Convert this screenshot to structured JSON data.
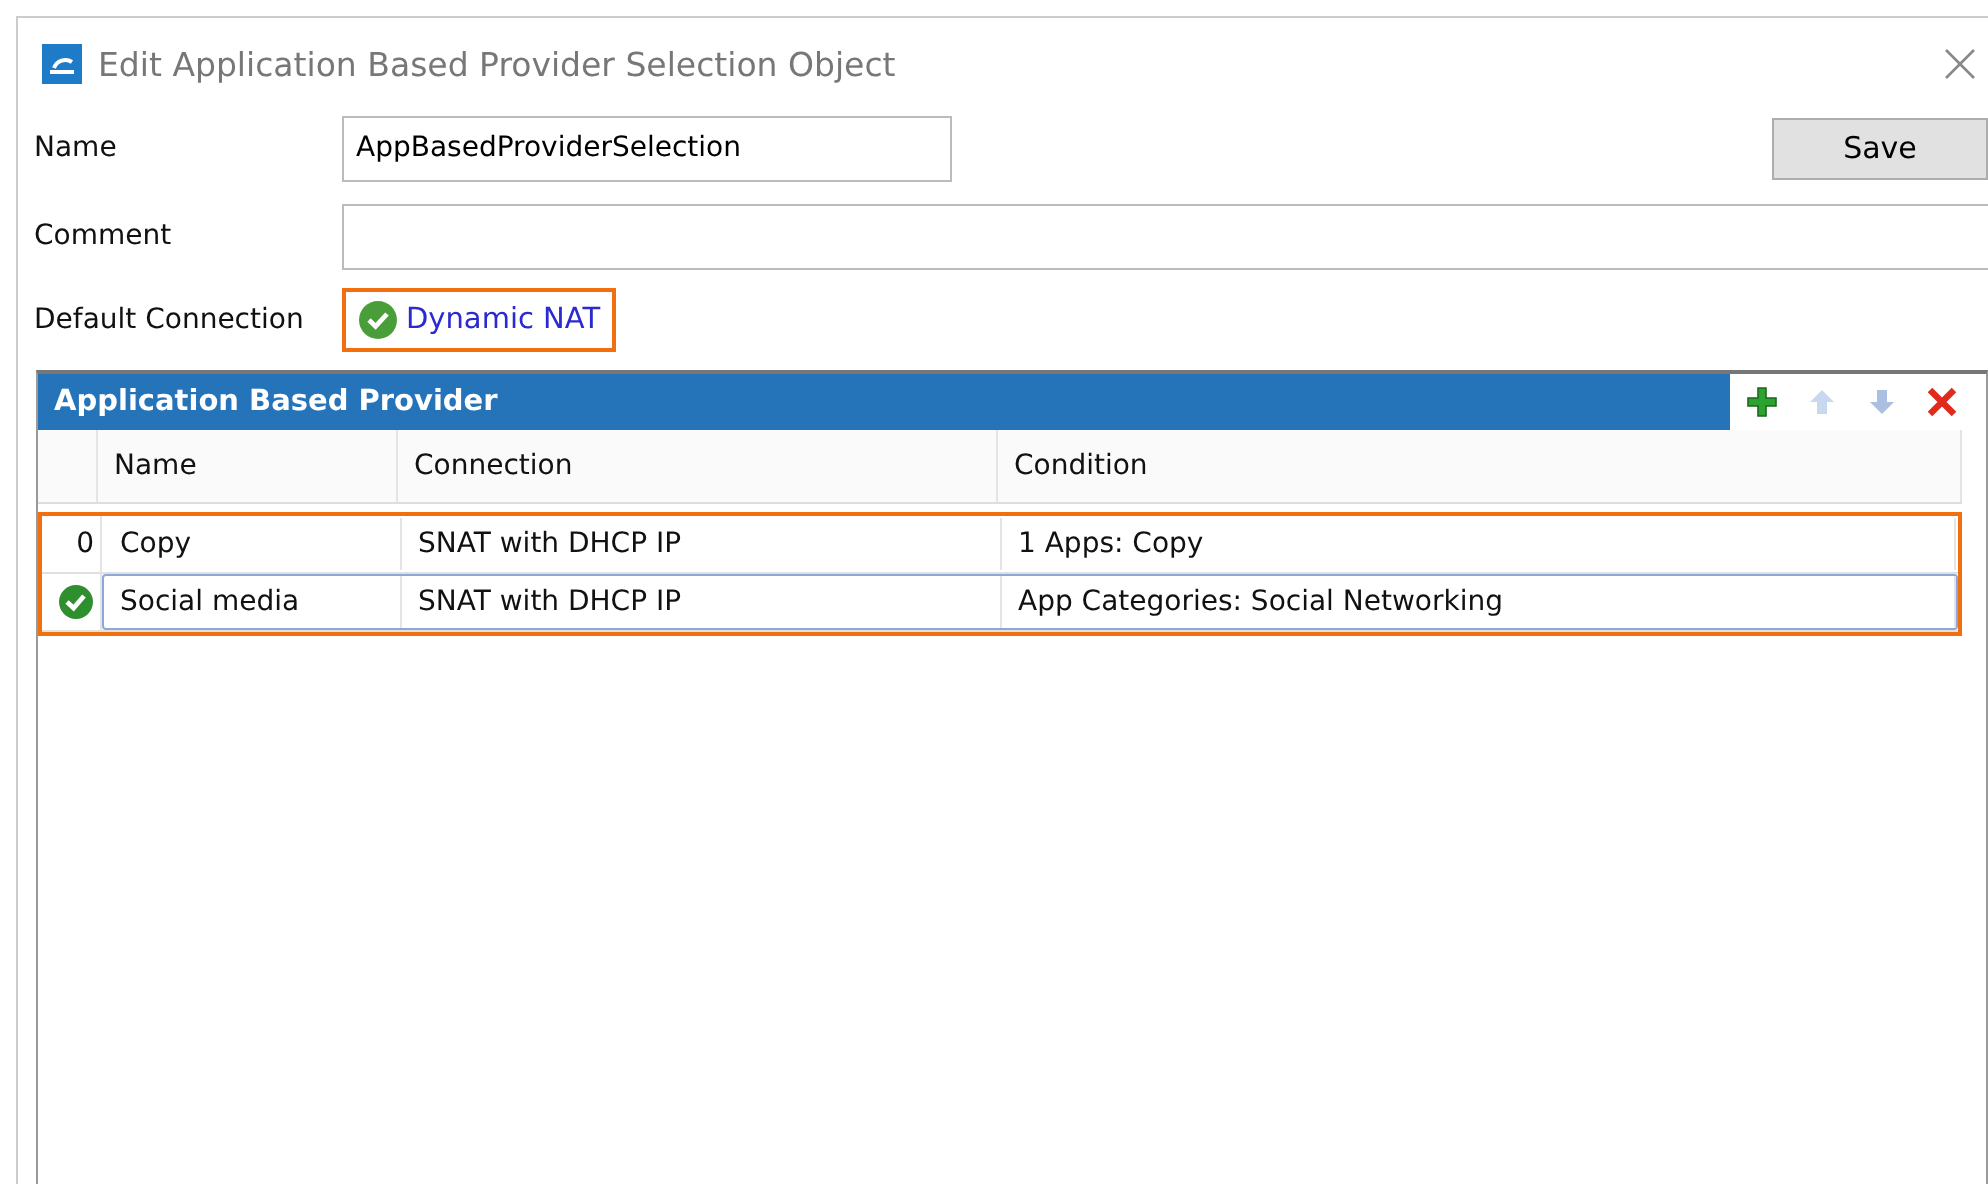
{
  "window": {
    "title": "Edit Application Based Provider Selection Object"
  },
  "form": {
    "name_label": "Name",
    "name_value": "AppBasedProviderSelection",
    "comment_label": "Comment",
    "save_button": "Save"
  },
  "default_connection": {
    "label": "Default Connection",
    "value": "Dynamic NAT",
    "highlighted": true
  },
  "table": {
    "title": "Application Based Provider",
    "rows_highlighted": true,
    "columns": [
      "Name",
      "Connection",
      "Condition"
    ],
    "rows": [
      {
        "row_header": "0",
        "selected": false,
        "cells": [
          "Copy",
          "SNAT with DHCP IP",
          "1 Apps: Copy"
        ]
      },
      {
        "selected": true,
        "cells": [
          "Social media",
          "SNAT with DHCP IP",
          "App Categories: Social Networking"
        ]
      }
    ]
  }
}
